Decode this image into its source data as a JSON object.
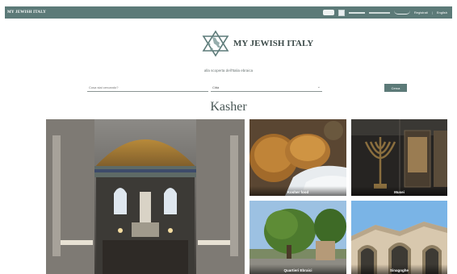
{
  "topbar": {
    "brand": "MY JEWISH ITALY",
    "nav": {
      "login": "Registrati",
      "sep": "|",
      "lang": "English"
    }
  },
  "hero": {
    "logo_title": "MY JEWISH ITALY",
    "subtitle": "alla scoperta dell'Italia ebraica"
  },
  "search": {
    "placeholder": "Cosa stai cercando?",
    "city_value": "Città",
    "button_label": "Cerca"
  },
  "section": {
    "title": "Kasher"
  },
  "tiles": [
    {
      "label": ""
    },
    {
      "label": "Kosher food"
    },
    {
      "label": "Musei"
    },
    {
      "label": "Quartieri Ebraici"
    },
    {
      "label": "Sinagoghe"
    }
  ],
  "colors": {
    "brand": "#5c7a78",
    "title": "#4a5857"
  }
}
